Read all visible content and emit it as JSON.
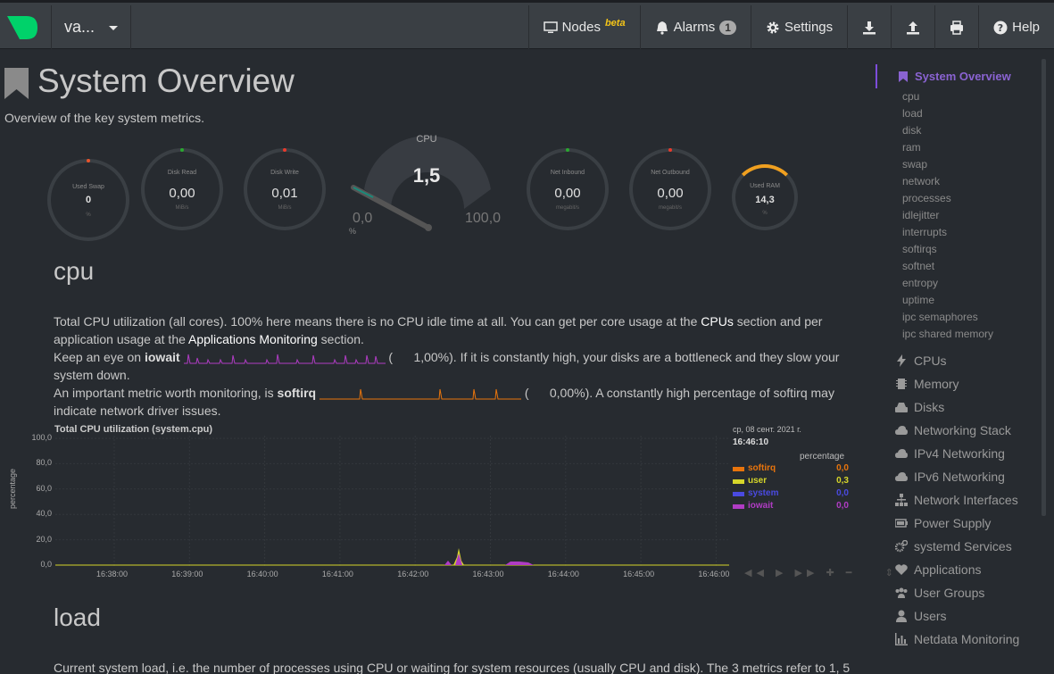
{
  "navbar": {
    "host": "va...",
    "nodes_label": "Nodes",
    "nodes_beta": "beta",
    "alarms_label": "Alarms",
    "alarms_count": "1",
    "settings_label": "Settings",
    "help_label": "Help"
  },
  "page": {
    "title": "System Overview",
    "subtitle": "Overview of the key system metrics."
  },
  "gauges": [
    {
      "label": "Used Swap",
      "value": "0",
      "unit": "%"
    },
    {
      "label": "Disk Read",
      "value": "0,00",
      "unit": "MiB/s"
    },
    {
      "label": "Disk Write",
      "value": "0,01",
      "unit": "MiB/s"
    },
    {
      "label": "Net Inbound",
      "value": "0,00",
      "unit": "megabit/s"
    },
    {
      "label": "Net Outbound",
      "value": "0,00",
      "unit": "megabit/s"
    },
    {
      "label": "Used RAM",
      "value": "14,3",
      "unit": "%"
    }
  ],
  "cpu_gauge": {
    "title": "CPU",
    "value": "1,5",
    "min": "0,0",
    "max": "100,0",
    "unit": "%"
  },
  "cpu_section": {
    "heading": "cpu",
    "p1a": "Total CPU utilization (all cores). 100% here means there is no CPU idle time at all. You can get per core usage at the ",
    "p1_link1": "CPUs",
    "p1b": " section and per application usage at the ",
    "p1_link2": "Applications Monitoring",
    "p1c": " section.",
    "p2a": "Keep an eye on ",
    "p2_bold": "iowait",
    "p2_val": "1,00%",
    "p2b": "). If it is constantly high, your disks are a bottleneck and they slow your system down.",
    "p3a": "An important metric worth monitoring, is ",
    "p3_bold": "softirq",
    "p3_val": "0,00%",
    "p3b": "). A constantly high percentage of softirq may indicate network driver issues."
  },
  "chart_data": {
    "type": "area",
    "title": "Total CPU utilization (system.cpu)",
    "ylabel": "percentage",
    "ylim": [
      0,
      100
    ],
    "yticks": [
      "100,0",
      "80,0",
      "60,0",
      "40,0",
      "20,0",
      "0,0"
    ],
    "xticks": [
      "16:38:00",
      "16:39:00",
      "16:40:00",
      "16:41:00",
      "16:42:00",
      "16:43:00",
      "16:44:00",
      "16:45:00",
      "16:46:00"
    ],
    "legend_date": "ср, 08 сент. 2021 г.",
    "legend_time": "16:46:10",
    "legend_header": "percentage",
    "series": [
      {
        "name": "softirq",
        "value": "0,0",
        "color": "#e8740c"
      },
      {
        "name": "user",
        "value": "0,3",
        "color": "#d6d62a"
      },
      {
        "name": "system",
        "value": "0,0",
        "color": "#4a4ae0"
      },
      {
        "name": "iowait",
        "value": "0,0",
        "color": "#b03cc4"
      }
    ]
  },
  "load_section": {
    "heading": "load",
    "p1": "Current system load, i.e. the number of processes using CPU or waiting for system resources (usually CPU and disk). The 3 metrics refer to 1, 5"
  },
  "sidebar": {
    "active": "System Overview",
    "subitems": [
      "cpu",
      "load",
      "disk",
      "ram",
      "swap",
      "network",
      "processes",
      "idlejitter",
      "interrupts",
      "softirqs",
      "softnet",
      "entropy",
      "uptime",
      "ipc semaphores",
      "ipc shared memory"
    ],
    "items": [
      {
        "label": "CPUs",
        "icon": "bolt-icon"
      },
      {
        "label": "Memory",
        "icon": "memory-icon"
      },
      {
        "label": "Disks",
        "icon": "hdd-icon"
      },
      {
        "label": "Networking Stack",
        "icon": "cloud-icon"
      },
      {
        "label": "IPv4 Networking",
        "icon": "cloud-icon"
      },
      {
        "label": "IPv6 Networking",
        "icon": "cloud-icon"
      },
      {
        "label": "Network Interfaces",
        "icon": "network-wired-icon"
      },
      {
        "label": "Power Supply",
        "icon": "battery-icon"
      },
      {
        "label": "systemd Services",
        "icon": "cogs-icon"
      },
      {
        "label": "Applications",
        "icon": "heartbeat-icon"
      },
      {
        "label": "User Groups",
        "icon": "users-icon"
      },
      {
        "label": "Users",
        "icon": "user-icon"
      },
      {
        "label": "Netdata Monitoring",
        "icon": "chart-bar-icon"
      }
    ]
  }
}
